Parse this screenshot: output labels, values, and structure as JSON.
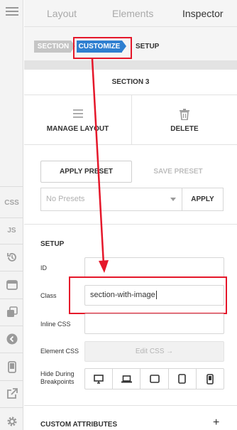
{
  "tabs": [
    {
      "label": "Layout",
      "active": false
    },
    {
      "label": "Elements",
      "active": false
    },
    {
      "label": "Inspector",
      "active": true
    }
  ],
  "rail": {
    "menu_icon": "hamburger-icon",
    "css_label": "CSS",
    "js_label": "JS",
    "icons": [
      "history-icon",
      "panel-icon",
      "stack-icon",
      "chevron-left-circle-icon",
      "mobile-preview-icon",
      "external-link-icon",
      "gear-icon"
    ]
  },
  "breadcrumb": {
    "items": [
      "SECTION",
      "CUSTOMIZE",
      "SETUP"
    ],
    "active_index": 1
  },
  "section_title": "SECTION 3",
  "actions": {
    "manage_layout": "MANAGE LAYOUT",
    "delete": "DELETE"
  },
  "presets": {
    "apply_preset": "APPLY PRESET",
    "save_preset": "SAVE PRESET",
    "select_value": "No Presets",
    "apply": "APPLY"
  },
  "setup": {
    "heading": "SETUP",
    "id_label": "ID",
    "id_value": "",
    "class_label": "Class",
    "class_value": "section-with-image",
    "inline_css_label": "Inline CSS",
    "inline_css_value": "",
    "element_css_label": "Element CSS",
    "edit_css_button": "Edit CSS →",
    "hide_label_line1": "Hide During",
    "hide_label_line2": "Breakpoints",
    "breakpoints": [
      "desktop-icon",
      "laptop-icon",
      "tablet-landscape-icon",
      "tablet-portrait-icon",
      "phone-icon"
    ]
  },
  "custom_attributes": {
    "heading": "CUSTOM ATTRIBUTES",
    "add": "+"
  },
  "colors": {
    "accent": "#2f7fd0",
    "highlight": "#e5172a"
  }
}
